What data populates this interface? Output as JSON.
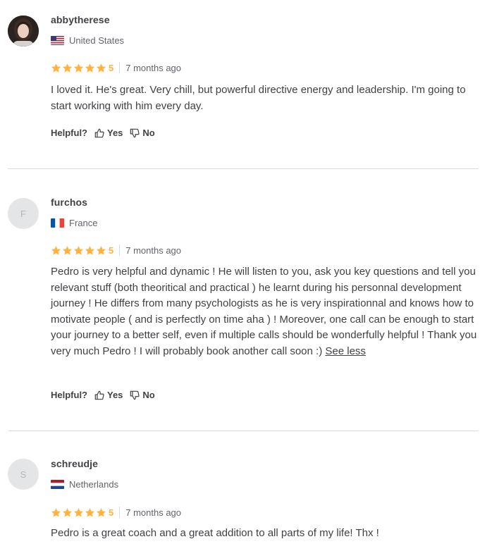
{
  "reviews": [
    {
      "username": "abbytherese",
      "avatar_type": "photo",
      "avatar_letter": "",
      "country": "United States",
      "flag": "us-flag",
      "rating": "5",
      "time": "7 months ago",
      "text": "I loved it. He's great. Very chill, but powerful directive energy and leadership. I'm going to start working with him every day.",
      "see_less": "",
      "helpful_label": "Helpful?",
      "yes_label": "Yes",
      "no_label": "No"
    },
    {
      "username": "furchos",
      "avatar_type": "letter",
      "avatar_letter": "F",
      "country": "France",
      "flag": "fr-flag",
      "rating": "5",
      "time": "7 months ago",
      "text": "Pedro is very helpful and dynamic ! He will listen to you, ask you key questions and tell you relevant stuff (both theoritical and practical ) he learnt during his personnal development journey ! He differs from many psychologists as he is very inspirationnal and knows how to motivate people ( and is perfectly on time aha ) ! Moreover, one call can be enough to start your journey to a better self, even if multiple calls should be wonderfully helpful ! Thank you very much Pedro ! I will probably book another call soon :)",
      "see_less": "See less",
      "helpful_label": "Helpful?",
      "yes_label": "Yes",
      "no_label": "No"
    },
    {
      "username": "schreudje",
      "avatar_type": "letter",
      "avatar_letter": "S",
      "country": "Netherlands",
      "flag": "nl-flag",
      "rating": "5",
      "time": "7 months ago",
      "text": "Pedro is a great coach and a great addition to all parts of my life! Thx !",
      "see_less": "",
      "helpful_label": "",
      "yes_label": "",
      "no_label": ""
    }
  ],
  "colors": {
    "star": "#ffb33e",
    "text": "#404145",
    "muted": "#62646a",
    "divider": "#dadbdd"
  }
}
